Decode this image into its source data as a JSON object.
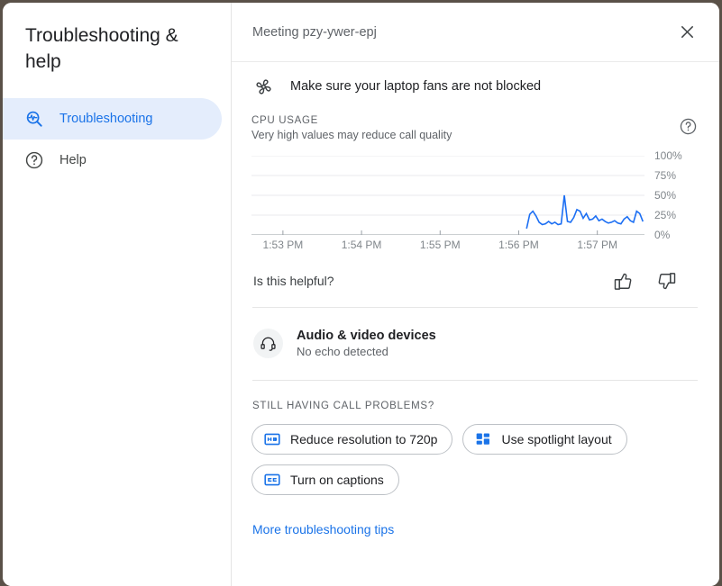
{
  "sidebar": {
    "title": "Troubleshooting & help",
    "items": [
      {
        "label": "Troubleshooting",
        "icon": "troubleshoot-icon",
        "active": true
      },
      {
        "label": "Help",
        "icon": "help-circle-icon",
        "active": false
      }
    ]
  },
  "header": {
    "meeting_title": "Meeting pzy-ywer-epj",
    "close_icon": "close-icon"
  },
  "tip": {
    "icon": "fan-icon",
    "text": "Make sure your laptop fans are not blocked"
  },
  "cpu": {
    "label": "CPU USAGE",
    "subtitle": "Very high values may reduce call quality",
    "help_icon": "help-circle-icon"
  },
  "feedback": {
    "question": "Is this helpful?",
    "thumb_up_icon": "thumb-up-icon",
    "thumb_down_icon": "thumb-down-icon"
  },
  "devices": {
    "icon": "headset-icon",
    "title": "Audio & video devices",
    "status": "No echo detected"
  },
  "problems": {
    "label": "STILL HAVING CALL PROBLEMS?",
    "chips": [
      {
        "label": "Reduce resolution to 720p",
        "icon": "hd-icon"
      },
      {
        "label": "Use spotlight layout",
        "icon": "spotlight-layout-icon"
      },
      {
        "label": "Turn on captions",
        "icon": "captions-icon"
      }
    ],
    "more_link": "More troubleshooting tips"
  },
  "colors": {
    "accent": "#1a73e8",
    "chart_line": "#1b6ef3",
    "active_nav_bg": "#e4edfc",
    "text_primary": "#202124",
    "text_secondary": "#5f6368"
  },
  "chart_data": {
    "type": "line",
    "title": "CPU USAGE",
    "subtitle": "Very high values may reduce call quality",
    "xlabel": "",
    "ylabel": "",
    "ylim": [
      0,
      100
    ],
    "ytick_labels": [
      "0%",
      "25%",
      "50%",
      "75%",
      "100%"
    ],
    "ytick_values": [
      0,
      25,
      50,
      75,
      100
    ],
    "xtick_labels": [
      "1:53 PM",
      "1:54 PM",
      "1:55 PM",
      "1:56 PM",
      "1:57 PM"
    ],
    "xlim_minutes": [
      52.6,
      57.6
    ],
    "grid": true,
    "legend": null,
    "series": [
      {
        "name": "CPU usage",
        "color": "#1b6ef3",
        "x": [
          56.1,
          56.14,
          56.18,
          56.22,
          56.26,
          56.3,
          56.34,
          56.38,
          56.42,
          56.46,
          56.5,
          56.54,
          56.58,
          56.62,
          56.66,
          56.7,
          56.74,
          56.78,
          56.82,
          56.86,
          56.9,
          56.94,
          56.98,
          57.02,
          57.06,
          57.1,
          57.14,
          57.18,
          57.22,
          57.26,
          57.3,
          57.34,
          57.38,
          57.42,
          57.46,
          57.5,
          57.54,
          57.58
        ],
        "values": [
          8,
          26,
          30,
          24,
          16,
          13,
          14,
          17,
          14,
          16,
          13,
          14,
          50,
          17,
          16,
          22,
          32,
          30,
          21,
          27,
          19,
          20,
          24,
          18,
          20,
          17,
          15,
          16,
          18,
          15,
          14,
          20,
          23,
          18,
          16,
          30,
          27,
          17
        ]
      }
    ]
  }
}
